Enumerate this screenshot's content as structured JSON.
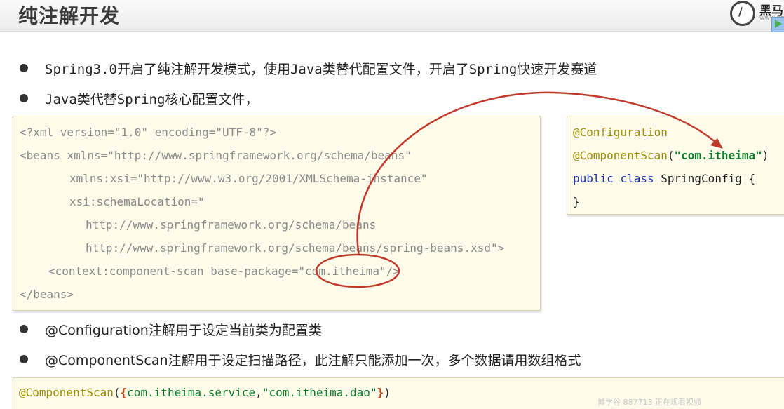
{
  "header": {
    "title": "纯注解开发",
    "logo_text": "黑马",
    "logo_url_fragment": "www.ith"
  },
  "bullets_top": [
    "Spring3.0开启了纯注解开发模式，使用Java类替代配置文件，开启了Spring快速开发赛道",
    "Java类代替Spring核心配置文件，"
  ],
  "xml": {
    "line1": "<?xml version=\"1.0\" encoding=\"UTF-8\"?>",
    "line2": "<beans xmlns=\"http://www.springframework.org/schema/beans\"",
    "line3": "xmlns:xsi=\"http://www.w3.org/2001/XMLSchema-instance\"",
    "line4": "xsi:schemaLocation=\"",
    "line5": "http://www.springframework.org/schema/beans",
    "line6": "http://www.springframework.org/schema/beans/spring-beans.xsd\">",
    "line7": "<context:component-scan base-package=\"com.itheima\"/>",
    "line8": "</beans>"
  },
  "java": {
    "anno1": "@Configuration",
    "anno2": "@ComponentScan",
    "anno2_open": "(",
    "anno2_value": "\"com.itheima\"",
    "anno2_close": ")",
    "kw1": "public",
    "kw2": "class",
    "class_decl": "SpringConfig {",
    "close": "}"
  },
  "bullets_bottom": [
    "@Configuration注解用于设定当前类为配置类",
    "@ComponentScan注解用于设定扫描路径，此注解只能添加一次，多个数据请用数组格式"
  ],
  "example": {
    "anno": "@ComponentScan",
    "open_paren": "(",
    "open_brace": "{",
    "value1": "com.itheima.service",
    "comma": ",",
    "value2": "\"com.itheima.dao\"",
    "close_brace": "}",
    "close_paren": ")"
  },
  "watermark": "博学谷 887713 正在观看视频",
  "colors": {
    "annotation": "#9b8a00",
    "keyword": "#1b2fa8",
    "string": "#0a7c2a",
    "code_bg": "#fefbea",
    "highlight_red": "#c0392b"
  }
}
